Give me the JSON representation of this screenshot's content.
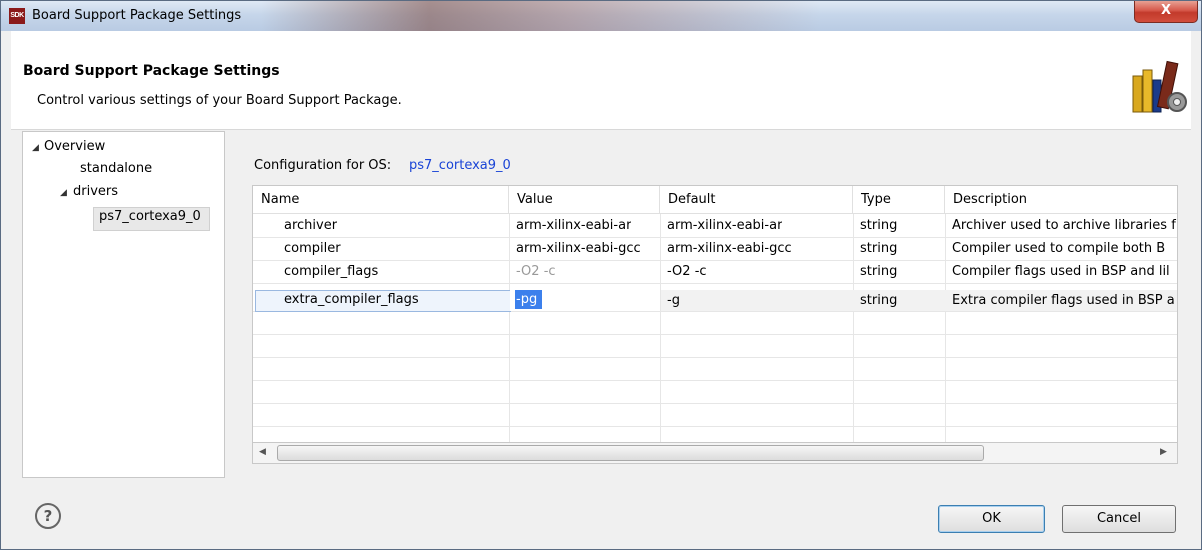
{
  "window": {
    "title": "Board Support Package Settings",
    "app_icon_label": "SDK",
    "close_label": "X"
  },
  "header": {
    "title": "Board Support Package Settings",
    "subtitle": "Control various settings of your Board Support Package."
  },
  "tree": {
    "overview": "Overview",
    "standalone": "standalone",
    "drivers": "drivers",
    "driver_item": "ps7_cortexa9_0"
  },
  "config": {
    "label": "Configuration for OS:",
    "os": "ps7_cortexa9_0"
  },
  "table": {
    "columns": [
      "Name",
      "Value",
      "Default",
      "Type",
      "Description"
    ],
    "rows": [
      {
        "name": "archiver",
        "value": "arm-xilinx-eabi-ar",
        "default": "arm-xilinx-eabi-ar",
        "type": "string",
        "description": "Archiver used to archive libraries f"
      },
      {
        "name": "compiler",
        "value": "arm-xilinx-eabi-gcc",
        "default": "arm-xilinx-eabi-gcc",
        "type": "string",
        "description": "Compiler used to compile both B"
      },
      {
        "name": "compiler_flags",
        "value": "-O2 -c",
        "default": "-O2 -c",
        "type": "string",
        "description": "Compiler flags used in BSP and lil"
      },
      {
        "name": "extra_compiler_flags",
        "value": "-pg",
        "default": "-g",
        "type": "string",
        "description": "Extra compiler flags used in BSP a"
      }
    ]
  },
  "buttons": {
    "help": "?",
    "ok": "OK",
    "cancel": "Cancel"
  },
  "icons": {
    "scroll_left": "◀",
    "scroll_right": "▶",
    "expand": "◢"
  },
  "colors": {
    "link": "#1a44d6",
    "selection": "#3c80ec"
  }
}
